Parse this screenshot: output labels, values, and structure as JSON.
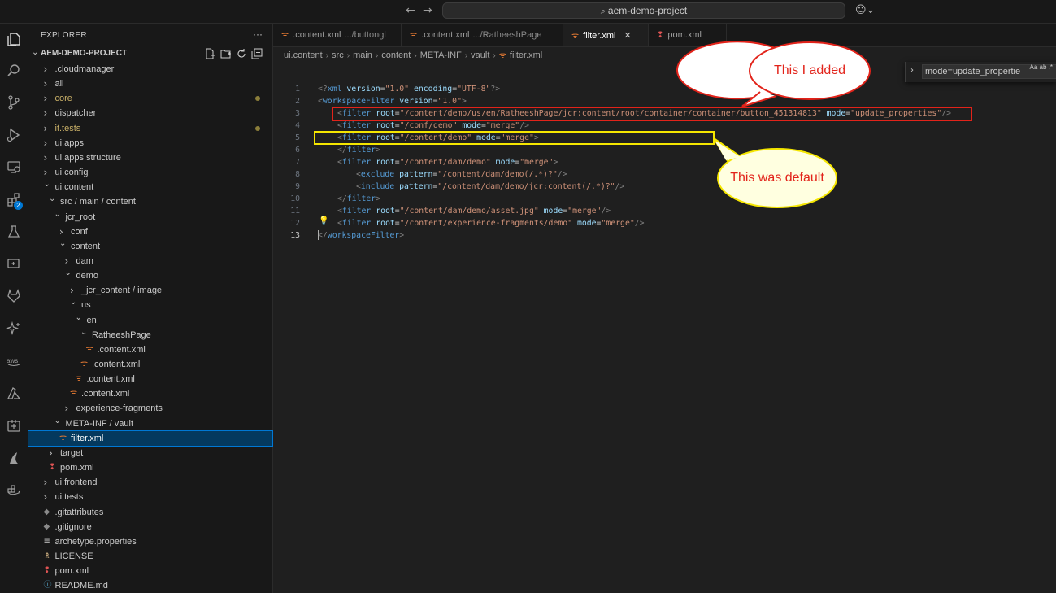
{
  "titlebar": {
    "back_icon": "arrow-left-icon",
    "forward_icon": "arrow-right-icon",
    "search_text": "aem-demo-project",
    "copilot_icon": "copilot-icon"
  },
  "activity_bar": {
    "items": [
      "explorer-icon",
      "search-icon",
      "source-control-icon",
      "run-debug-icon",
      "remote-explorer-icon",
      "extensions-icon",
      "testing-icon",
      "copilot-chat-icon",
      "gitlab-icon",
      "ai-sparkle-icon",
      "aws-icon",
      "azure-icon",
      "containers-icon",
      "adobe-icon",
      "docker-icon"
    ],
    "extensions_badge": "2"
  },
  "sidebar": {
    "title": "EXPLORER",
    "more": "···",
    "project": "AEM-DEMO-PROJECT",
    "tree": [
      {
        "label": ".cloudmanager",
        "type": "folder",
        "open": false,
        "depth": 1
      },
      {
        "label": "all",
        "type": "folder",
        "open": false,
        "depth": 1
      },
      {
        "label": "core",
        "type": "folder",
        "open": false,
        "depth": 1,
        "modified": true
      },
      {
        "label": "dispatcher",
        "type": "folder",
        "open": false,
        "depth": 1
      },
      {
        "label": "it.tests",
        "type": "folder",
        "open": false,
        "depth": 1,
        "modified": true
      },
      {
        "label": "ui.apps",
        "type": "folder",
        "open": false,
        "depth": 1
      },
      {
        "label": "ui.apps.structure",
        "type": "folder",
        "open": false,
        "depth": 1
      },
      {
        "label": "ui.config",
        "type": "folder",
        "open": false,
        "depth": 1
      },
      {
        "label": "ui.content",
        "type": "folder",
        "open": true,
        "depth": 1
      },
      {
        "label": "src / main / content",
        "type": "folder",
        "open": true,
        "depth": 2
      },
      {
        "label": "jcr_root",
        "type": "folder",
        "open": true,
        "depth": 3
      },
      {
        "label": "conf",
        "type": "folder",
        "open": false,
        "depth": 4
      },
      {
        "label": "content",
        "type": "folder",
        "open": true,
        "depth": 4
      },
      {
        "label": "dam",
        "type": "folder",
        "open": false,
        "depth": 5
      },
      {
        "label": "demo",
        "type": "folder",
        "open": true,
        "depth": 5
      },
      {
        "label": "_jcr_content / image",
        "type": "folder",
        "open": false,
        "depth": 6
      },
      {
        "label": "us",
        "type": "folder",
        "open": true,
        "depth": 6
      },
      {
        "label": "en",
        "type": "folder",
        "open": true,
        "depth": 7
      },
      {
        "label": "RatheeshPage",
        "type": "folder",
        "open": true,
        "depth": 8
      },
      {
        "label": ".content.xml",
        "type": "xml",
        "depth": 9
      },
      {
        "label": ".content.xml",
        "type": "xml",
        "depth": 8
      },
      {
        "label": ".content.xml",
        "type": "xml",
        "depth": 7
      },
      {
        "label": ".content.xml",
        "type": "xml",
        "depth": 6
      },
      {
        "label": "experience-fragments",
        "type": "folder",
        "open": false,
        "depth": 5
      },
      {
        "label": "META-INF / vault",
        "type": "folder",
        "open": true,
        "depth": 3
      },
      {
        "label": "filter.xml",
        "type": "xml",
        "depth": 4,
        "selected": true
      },
      {
        "label": "target",
        "type": "folder",
        "open": false,
        "depth": 2
      },
      {
        "label": "pom.xml",
        "type": "pom",
        "depth": 2
      },
      {
        "label": "ui.frontend",
        "type": "folder",
        "open": false,
        "depth": 1
      },
      {
        "label": "ui.tests",
        "type": "folder",
        "open": false,
        "depth": 1
      },
      {
        "label": ".gitattributes",
        "type": "git",
        "depth": 1
      },
      {
        "label": ".gitignore",
        "type": "git",
        "depth": 1
      },
      {
        "label": "archetype.properties",
        "type": "props",
        "depth": 1
      },
      {
        "label": "LICENSE",
        "type": "license",
        "depth": 1
      },
      {
        "label": "pom.xml",
        "type": "pom",
        "depth": 1
      },
      {
        "label": "README.md",
        "type": "info",
        "depth": 1
      }
    ]
  },
  "tabs": [
    {
      "name": ".content.xml",
      "desc": ".../buttongl",
      "active": false
    },
    {
      "name": ".content.xml",
      "desc": ".../RatheeshPage",
      "active": false
    },
    {
      "name": "filter.xml",
      "desc": "",
      "active": true
    },
    {
      "name": "pom.xml",
      "desc": "",
      "active": false
    }
  ],
  "breadcrumb": [
    "ui.content",
    "src",
    "main",
    "content",
    "META-INF",
    "vault",
    "filter.xml"
  ],
  "find": {
    "value": "mode=update_propertie",
    "options": "Aa  ab  .*"
  },
  "code": {
    "line_numbers": [
      "1",
      "2",
      "3",
      "4",
      "5",
      "6",
      "7",
      "8",
      "9",
      "10",
      "11",
      "12",
      "13"
    ],
    "l1": {
      "a": "<?",
      "b": "xml",
      "c": " version",
      "d": "=",
      "e": "\"1.0\"",
      "f": " encoding",
      "g": "=",
      "h": "\"UTF-8\"",
      "i": "?>"
    },
    "l2": {
      "a": "<",
      "b": "workspaceFilter",
      "c": " version",
      "d": "=",
      "e": "\"1.0\"",
      "f": ">"
    },
    "l3": {
      "a": "<",
      "b": "filter",
      "c": " root",
      "d": "=",
      "e": "\"/content/demo/us/en/RatheeshPage/jcr:content/root/container/container/button_451314813\"",
      "f": " mode",
      "g": "=",
      "h": "\"update_properties\"",
      "i": "/>"
    },
    "l4": {
      "a": "<",
      "b": "filter",
      "c": " root",
      "d": "=",
      "e": "\"/conf/demo\"",
      "f": " mode",
      "g": "=",
      "h": "\"merge\"",
      "i": "/>"
    },
    "l5": {
      "a": "<",
      "b": "filter",
      "c": " root",
      "d": "=",
      "e": "\"/content/demo\"",
      "f": " mode",
      "g": "=",
      "h": "\"merge\"",
      "i": ">"
    },
    "l6": {
      "a": "</",
      "b": "filter",
      "c": ">"
    },
    "l7": {
      "a": "<",
      "b": "filter",
      "c": " root",
      "d": "=",
      "e": "\"/content/dam/demo\"",
      "f": " mode",
      "g": "=",
      "h": "\"merge\"",
      "i": ">"
    },
    "l8": {
      "a": "<",
      "b": "exclude",
      "c": " pattern",
      "d": "=",
      "e": "\"/content/dam/demo(/.*)?\"",
      "f": "/>"
    },
    "l9": {
      "a": "<",
      "b": "include",
      "c": " pattern",
      "d": "=",
      "e": "\"/content/dam/demo/jcr:content(/.*)?\"",
      "f": "/>"
    },
    "l10": {
      "a": "</",
      "b": "filter",
      "c": ">"
    },
    "l11": {
      "a": "<",
      "b": "filter",
      "c": " root",
      "d": "=",
      "e": "\"/content/dam/demo/asset.jpg\"",
      "f": " mode",
      "g": "=",
      "h": "\"merge\"",
      "i": "/>"
    },
    "l12": {
      "a": "<",
      "b": "filter",
      "c": " root",
      "d": "=",
      "e": "\"/content/experience-fragments/demo\"",
      "f": " mode",
      "g": "=",
      "h": "\"merge\"",
      "i": "/>"
    },
    "l13": {
      "a": "</",
      "b": "workspaceFilter",
      "c": ">"
    }
  },
  "annotations": {
    "added": "This I added",
    "default": "This was default",
    "red": "#e2231a",
    "yellow": "#f5e600"
  }
}
